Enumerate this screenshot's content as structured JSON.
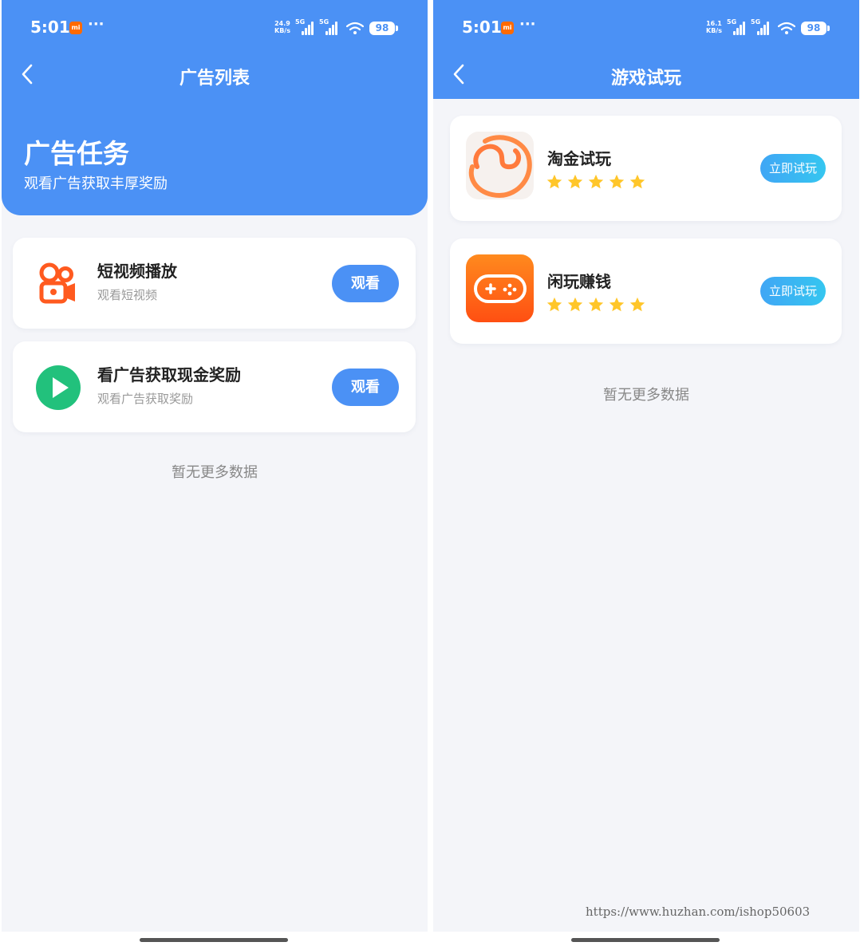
{
  "colors": {
    "primary": "#4b91f5",
    "page_bg": "#f4f5f9",
    "kuaishou_orange": "#ff5a1f",
    "play_green": "#22c17c",
    "star_yellow": "#ffc62a"
  },
  "left_screen": {
    "status": {
      "time": "5:01",
      "dots": "···",
      "speed_value": "24.9",
      "speed_unit": "KB/s",
      "net_tag": "5G",
      "battery": "98"
    },
    "nav": {
      "title": "广告列表"
    },
    "hero": {
      "title": "广告任务",
      "subtitle": "观看广告获取丰厚奖励"
    },
    "ads": [
      {
        "title": "短视频播放",
        "subtitle": "观看短视频",
        "button": "观看",
        "icon": "kuaishou-icon"
      },
      {
        "title": "看广告获取现金奖励",
        "subtitle": "观看广告获取奖励",
        "button": "观看",
        "icon": "play-icon"
      }
    ],
    "empty_text": "暂无更多数据"
  },
  "right_screen": {
    "status": {
      "time": "5:01",
      "dots": "···",
      "speed_value": "16.1",
      "speed_unit": "KB/s",
      "net_tag": "5G",
      "battery": "98"
    },
    "nav": {
      "title": "游戏试玩"
    },
    "games": [
      {
        "title": "淘金试玩",
        "rating": 5,
        "button": "立即试玩",
        "icon": "taojin-icon"
      },
      {
        "title": "闲玩赚钱",
        "rating": 5,
        "button": "立即试玩",
        "icon": "gamepad-icon"
      }
    ],
    "empty_text": "暂无更多数据"
  },
  "watermark": "https://www.huzhan.com/ishop50603"
}
